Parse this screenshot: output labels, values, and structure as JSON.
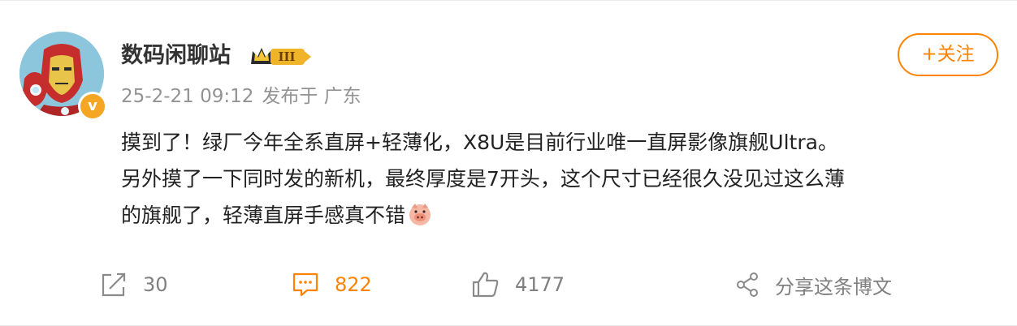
{
  "post": {
    "author": {
      "name": "数码闲聊站",
      "verified_mark": "v",
      "badge_level": "III",
      "avatar_icon": "iron-man-avatar"
    },
    "meta": {
      "time": "25-2-21 09:12",
      "location": "发布于 广东"
    },
    "follow_label": "+关注",
    "content": {
      "lines": [
        "摸到了！绿厂今年全系直屏+轻薄化，X8U是目前行业唯一直屏影像旗舰Ultra。",
        "另外摸了一下同时发的新机，最终厚度是7开头，这个尺寸已经很久没见过这么薄",
        "的旗舰了，轻薄直屏手感真不错"
      ],
      "trailing_emoji": "pig-face-emoji"
    },
    "actions": {
      "repost_count": "30",
      "comment_count": "822",
      "like_count": "4177",
      "share_label": "分享这条博文"
    },
    "colors": {
      "accent": "#ff8200",
      "meta_text": "#939393",
      "verified": "#f5a623"
    }
  }
}
